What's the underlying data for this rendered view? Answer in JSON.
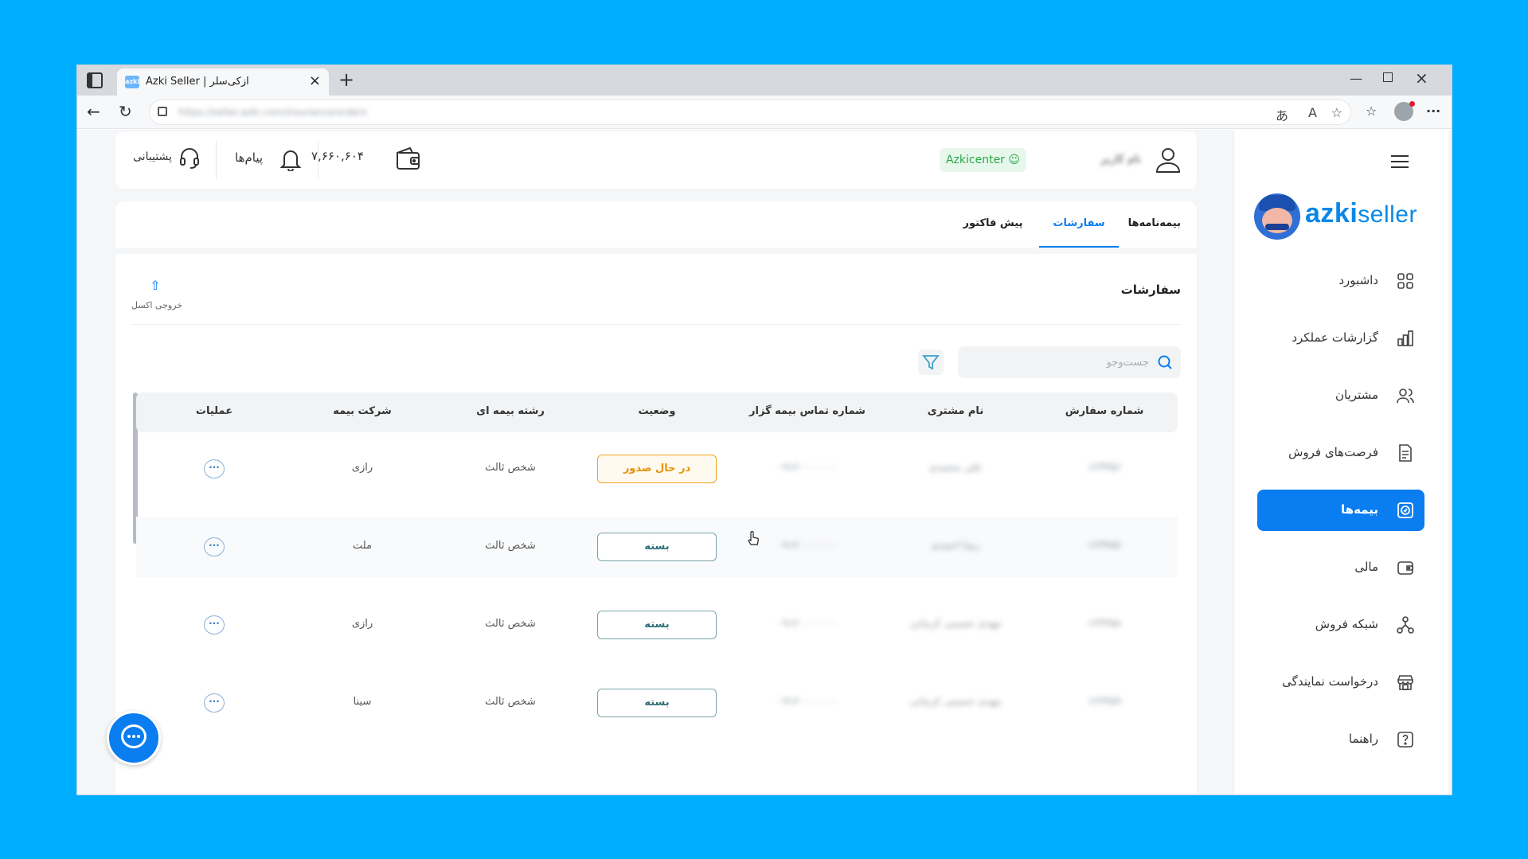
{
  "browser": {
    "tab_title": "Azki Seller | ازکی‌سلر",
    "tab_favicon": "azki",
    "url": "https://seller.azki.com/insurance/orders"
  },
  "header": {
    "user_name": "نام کاربر",
    "badge": "Azkicenter",
    "wallet_amount": "۷,۶۶۰,۶۰۴",
    "messages_label": "پیام‌ها",
    "support_label": "پشتیبانی"
  },
  "sidebar": {
    "logo_text_bold": "azki",
    "logo_text_light": "seller",
    "items": [
      {
        "label": "داشبورد",
        "icon": "dashboard-icon"
      },
      {
        "label": "گزارشات عملکرد",
        "icon": "chart-icon"
      },
      {
        "label": "مشتریان",
        "icon": "users-icon"
      },
      {
        "label": "فرصت‌های فروش",
        "icon": "document-icon"
      },
      {
        "label": "بیمه‌ها",
        "icon": "insurance-icon"
      },
      {
        "label": "مالی",
        "icon": "wallet-icon"
      },
      {
        "label": "شبکه فروش",
        "icon": "network-icon"
      },
      {
        "label": "درخواست نمایندگی",
        "icon": "store-icon"
      },
      {
        "label": "راهنما",
        "icon": "help-icon"
      }
    ],
    "active_index": 4
  },
  "main": {
    "tabs": [
      "بیمه‌نامه‌ها",
      "سفارشات",
      "پیش فاکتور"
    ],
    "active_tab": 1,
    "section_title": "سفارشات",
    "export_label": "خروجی اکسل",
    "search_placeholder": "جست‌وجو",
    "columns": [
      "شماره سفارش",
      "نام مشتری",
      "شماره تماس بیمه گزار",
      "وضعیت",
      "رشته بیمه ای",
      "شرکت بیمه",
      "عملیات"
    ],
    "rows": [
      {
        "order": "۱۲۳۴۵۶",
        "customer": "علی محمدی",
        "phone": "۰۹۱۲۰۰۰۰۰۰۰",
        "status": "در حال صدور",
        "status_type": "issuing",
        "line": "شخص ثالث",
        "company": "رازی",
        "actions": "···"
      },
      {
        "order": "۱۲۳۴۵۷",
        "customer": "رضا احمدی",
        "phone": "۰۹۱۲۰۰۰۰۰۰۰",
        "status": "بسته",
        "status_type": "closed",
        "line": "شخص ثالث",
        "company": "ملت",
        "actions": "···"
      },
      {
        "order": "۱۲۳۴۵۸",
        "customer": "مهدی حسینی کرمانی",
        "phone": "۰۹۱۲۰۰۰۰۰۰۰",
        "status": "بسته",
        "status_type": "closed",
        "line": "شخص ثالث",
        "company": "رازی",
        "actions": "···"
      },
      {
        "order": "۱۲۳۴۵۹",
        "customer": "مهدی حسینی کرمانی",
        "phone": "۰۹۱۲۰۰۰۰۰۰۰",
        "status": "بسته",
        "status_type": "closed",
        "line": "شخص ثالث",
        "company": "سینا",
        "actions": "···"
      }
    ]
  },
  "colors": {
    "accent": "#0a7df0",
    "background": "#00aeff",
    "issuing": "#f2a31b",
    "closed": "#2f6f75",
    "badge_green": "#2aa84a"
  }
}
